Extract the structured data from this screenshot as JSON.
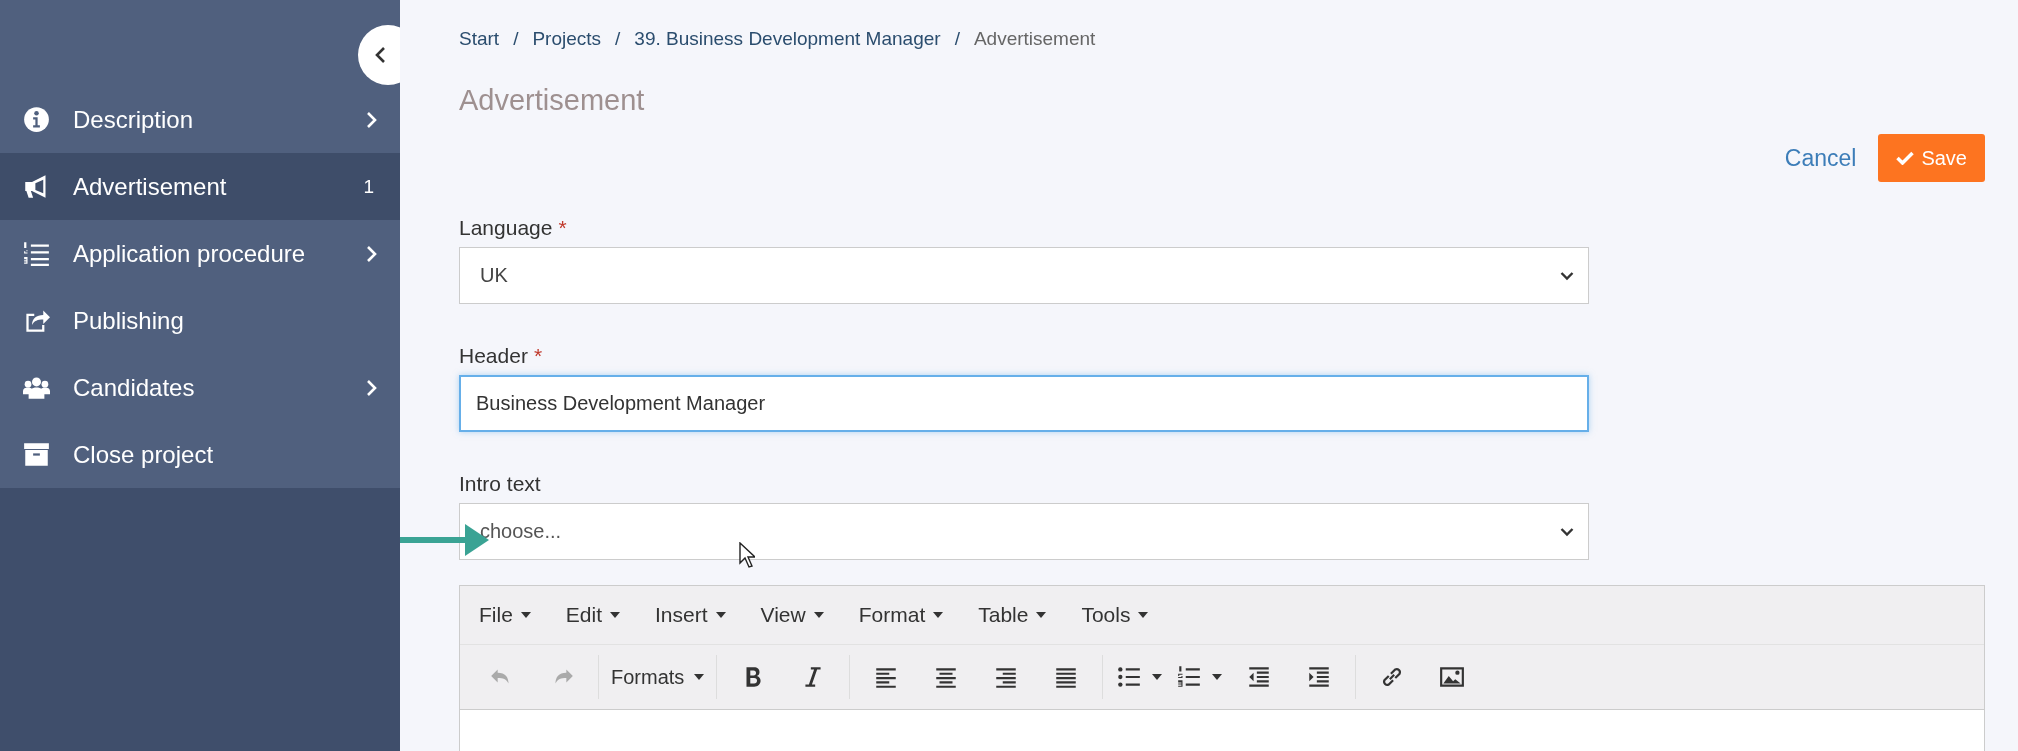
{
  "sidebar": {
    "collapse_button": {
      "expanded": true
    },
    "items": [
      {
        "label": "Description",
        "submenu": true,
        "selected": false
      },
      {
        "label": "Advertisement",
        "submenu": false,
        "badge": "1",
        "selected": true
      },
      {
        "label": "Application procedure",
        "submenu": true,
        "selected": false
      },
      {
        "label": "Publishing",
        "submenu": false,
        "selected": false
      },
      {
        "label": "Candidates",
        "submenu": true,
        "selected": false
      },
      {
        "label": "Close project",
        "submenu": false,
        "selected": false
      }
    ]
  },
  "breadcrumb": {
    "separator": "/",
    "items": [
      {
        "label": "Start",
        "link": true
      },
      {
        "label": "Projects",
        "link": true
      },
      {
        "label": "39. Business Development Manager",
        "link": true
      },
      {
        "label": "Advertisement",
        "link": false
      }
    ]
  },
  "title": "Advertisement",
  "actions": {
    "cancel": "Cancel",
    "save": "Save"
  },
  "fields": [
    {
      "kind": "select",
      "label": "Language",
      "required_mark": "*",
      "value": "UK",
      "focused": false
    },
    {
      "kind": "text",
      "label": "Header",
      "required_mark": "*",
      "value": "Business Development Manager",
      "focused": true
    },
    {
      "kind": "select",
      "label": "Intro text",
      "placeholder": "choose...",
      "focused": false,
      "pointer_arrow": true
    }
  ],
  "editor": {
    "menus": [
      "File",
      "Edit",
      "Insert",
      "View",
      "Format",
      "Table",
      "Tools"
    ],
    "toolbar": [
      [
        {
          "kind": "icon",
          "disabled": true
        },
        {
          "kind": "icon",
          "disabled": true
        }
      ],
      [
        {
          "kind": "dropdown",
          "label": "Formats",
          "disabled": false
        }
      ],
      [
        {
          "kind": "icon",
          "disabled": false
        },
        {
          "kind": "icon",
          "disabled": false
        }
      ],
      [
        {
          "kind": "icon",
          "disabled": false
        },
        {
          "kind": "icon",
          "disabled": false
        },
        {
          "kind": "icon",
          "disabled": false
        },
        {
          "kind": "icon",
          "disabled": false
        }
      ],
      [
        {
          "kind": "split",
          "disabled": false
        },
        {
          "kind": "split",
          "disabled": false
        },
        {
          "kind": "icon",
          "disabled": false
        },
        {
          "kind": "icon",
          "disabled": false
        }
      ],
      [
        {
          "kind": "icon",
          "disabled": false
        },
        {
          "kind": "icon",
          "disabled": false
        }
      ]
    ]
  }
}
